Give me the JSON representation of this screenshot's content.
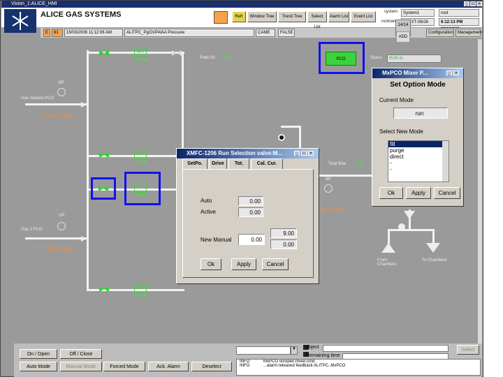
{
  "window": {
    "title": "Vision_1:ALICE_HMI"
  },
  "header": {
    "brand": "ALICE GAS SYSTEMS",
    "buttons": [
      "Window Tree",
      "Trend Tree",
      "Select List",
      "Alarm List",
      "Event List"
    ],
    "user_btn": "Refr",
    "system_label": "system",
    "system_value": "System1",
    "user_value": "root",
    "rootname_label": "rootname",
    "rootname_value": "XTEXT-06/26",
    "page_info": "14/14",
    "time_value": "6:12:13 PM 03/13/200",
    "config_btn": "Configuration",
    "mgmt_btn": "Management",
    "nav_btn": "ADD"
  },
  "infobar": {
    "e_label": "E",
    "count": "61",
    "date": "15/03/2006 11:12:06 AM",
    "path": "ALITPC_PgCh/PAlAA Pressure",
    "came": "CAME",
    "false": "FALSE"
  },
  "synoptic": {
    "ratio_label": "Ratio 61",
    "ratio_value": "0.000",
    "readout_top": "3175.2 mBar",
    "readout_bottom": "3220.5 mBar",
    "readout_right": "53.5 mBar",
    "gas_label_top": "Gas mixture PCO",
    "gas_label_bottom": "Gas 2 PCO",
    "total_flow_label": "Total flow",
    "total_flow_value": "0.00",
    "mfc_values": [
      "0.00 ln",
      "0.00 ln",
      "0.00 ln",
      "0.00 ln"
    ],
    "status_label": "Status",
    "status_value": "RUN m",
    "mode_badge": "PCO",
    "from_label": "From Chambers",
    "to_label": "To Chambers",
    "bp_labels": [
      "BP",
      "BP",
      "UP",
      "BP",
      "BP"
    ]
  },
  "mixer_dialog": {
    "title": "MxPCO Mixer P...",
    "heading": "Set Option Mode",
    "current_label": "Current Mode",
    "current_value": "run",
    "select_label": "Select New Mode",
    "options": [
      "fill",
      "purge",
      "direct",
      "-",
      "-"
    ],
    "selected_option": "fill",
    "ok": "Ok",
    "apply": "Apply",
    "cancel": "Cancel"
  },
  "mfc_dialog": {
    "title": "XMFC-1206 Run Selection valve:M...",
    "tabs": [
      "SetPo.",
      "Drive",
      "Tot.",
      "Cal. Cur."
    ],
    "auto_label": "Auto",
    "auto_value": "0.00",
    "active_label": "Active",
    "active_value": "0.00",
    "new_manual_label": "New Manual",
    "new_manual_value": "0.00",
    "range_max": "9.00",
    "range_min": "0.00",
    "ok": "Ok",
    "apply": "Apply",
    "cancel": "Cancel"
  },
  "bottom": {
    "buttons": [
      "On / Open",
      "Off / Close",
      "Auto Mode",
      "Manual Mode",
      "Forced Mode",
      "Ack. Alarm",
      "Deselect"
    ],
    "object_label": "object",
    "remaining_label": "Remaining time",
    "select_btn": "Select",
    "log_lines": [
      {
        "level": "INFO",
        "text": "MxPCO on/open:mixer.cmd."
      },
      {
        "level": "INFO",
        "text": "...alarm:released  feedback  ALITPC..MxPCO"
      }
    ]
  }
}
